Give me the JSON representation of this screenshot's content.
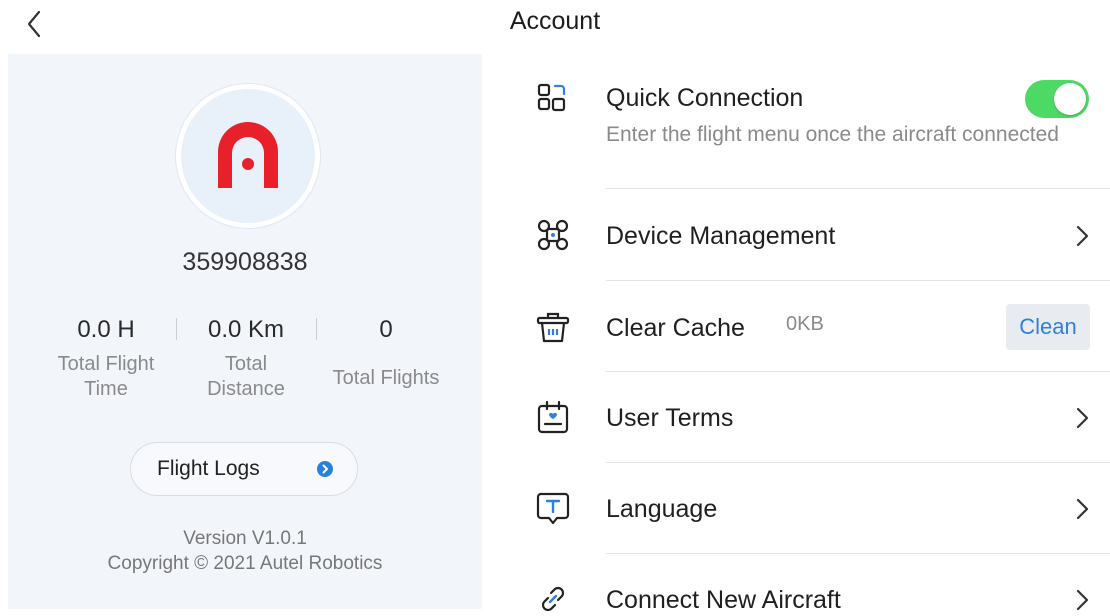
{
  "header": {
    "title": "Account",
    "back_icon": "chevron-left-icon"
  },
  "profile": {
    "avatar_icon": "autel-logo-icon",
    "user_id": "359908838",
    "stats": [
      {
        "value": "0.0 H",
        "label_line1": "Total Flight",
        "label_line2": "Time"
      },
      {
        "value": "0.0 Km",
        "label_line1": "Total",
        "label_line2": "Distance"
      },
      {
        "value": "0",
        "label_line1": "Total Flights",
        "label_line2": ""
      }
    ],
    "flight_logs_label": "Flight Logs",
    "version": "Version V1.0.1",
    "copyright": "Copyright © 2021 Autel Robotics"
  },
  "settings": {
    "quick_connection": {
      "label": "Quick Connection",
      "description": "Enter the flight menu once the aircraft connected",
      "enabled": true,
      "icon": "scan-connect-icon"
    },
    "device_management": {
      "label": "Device Management",
      "icon": "drone-icon"
    },
    "clear_cache": {
      "label": "Clear Cache",
      "size": "0KB",
      "button": "Clean",
      "icon": "trash-icon"
    },
    "user_terms": {
      "label": "User Terms",
      "icon": "terms-calendar-icon"
    },
    "language": {
      "label": "Language",
      "icon": "language-icon"
    },
    "connect_new_aircraft": {
      "label": "Connect New Aircraft",
      "icon": "link-icon"
    }
  },
  "colors": {
    "toggle_on": "#4cd964",
    "accent_blue": "#2e7fe0",
    "logo_red": "#e8202a",
    "panel_bg": "#f2f5fa"
  }
}
